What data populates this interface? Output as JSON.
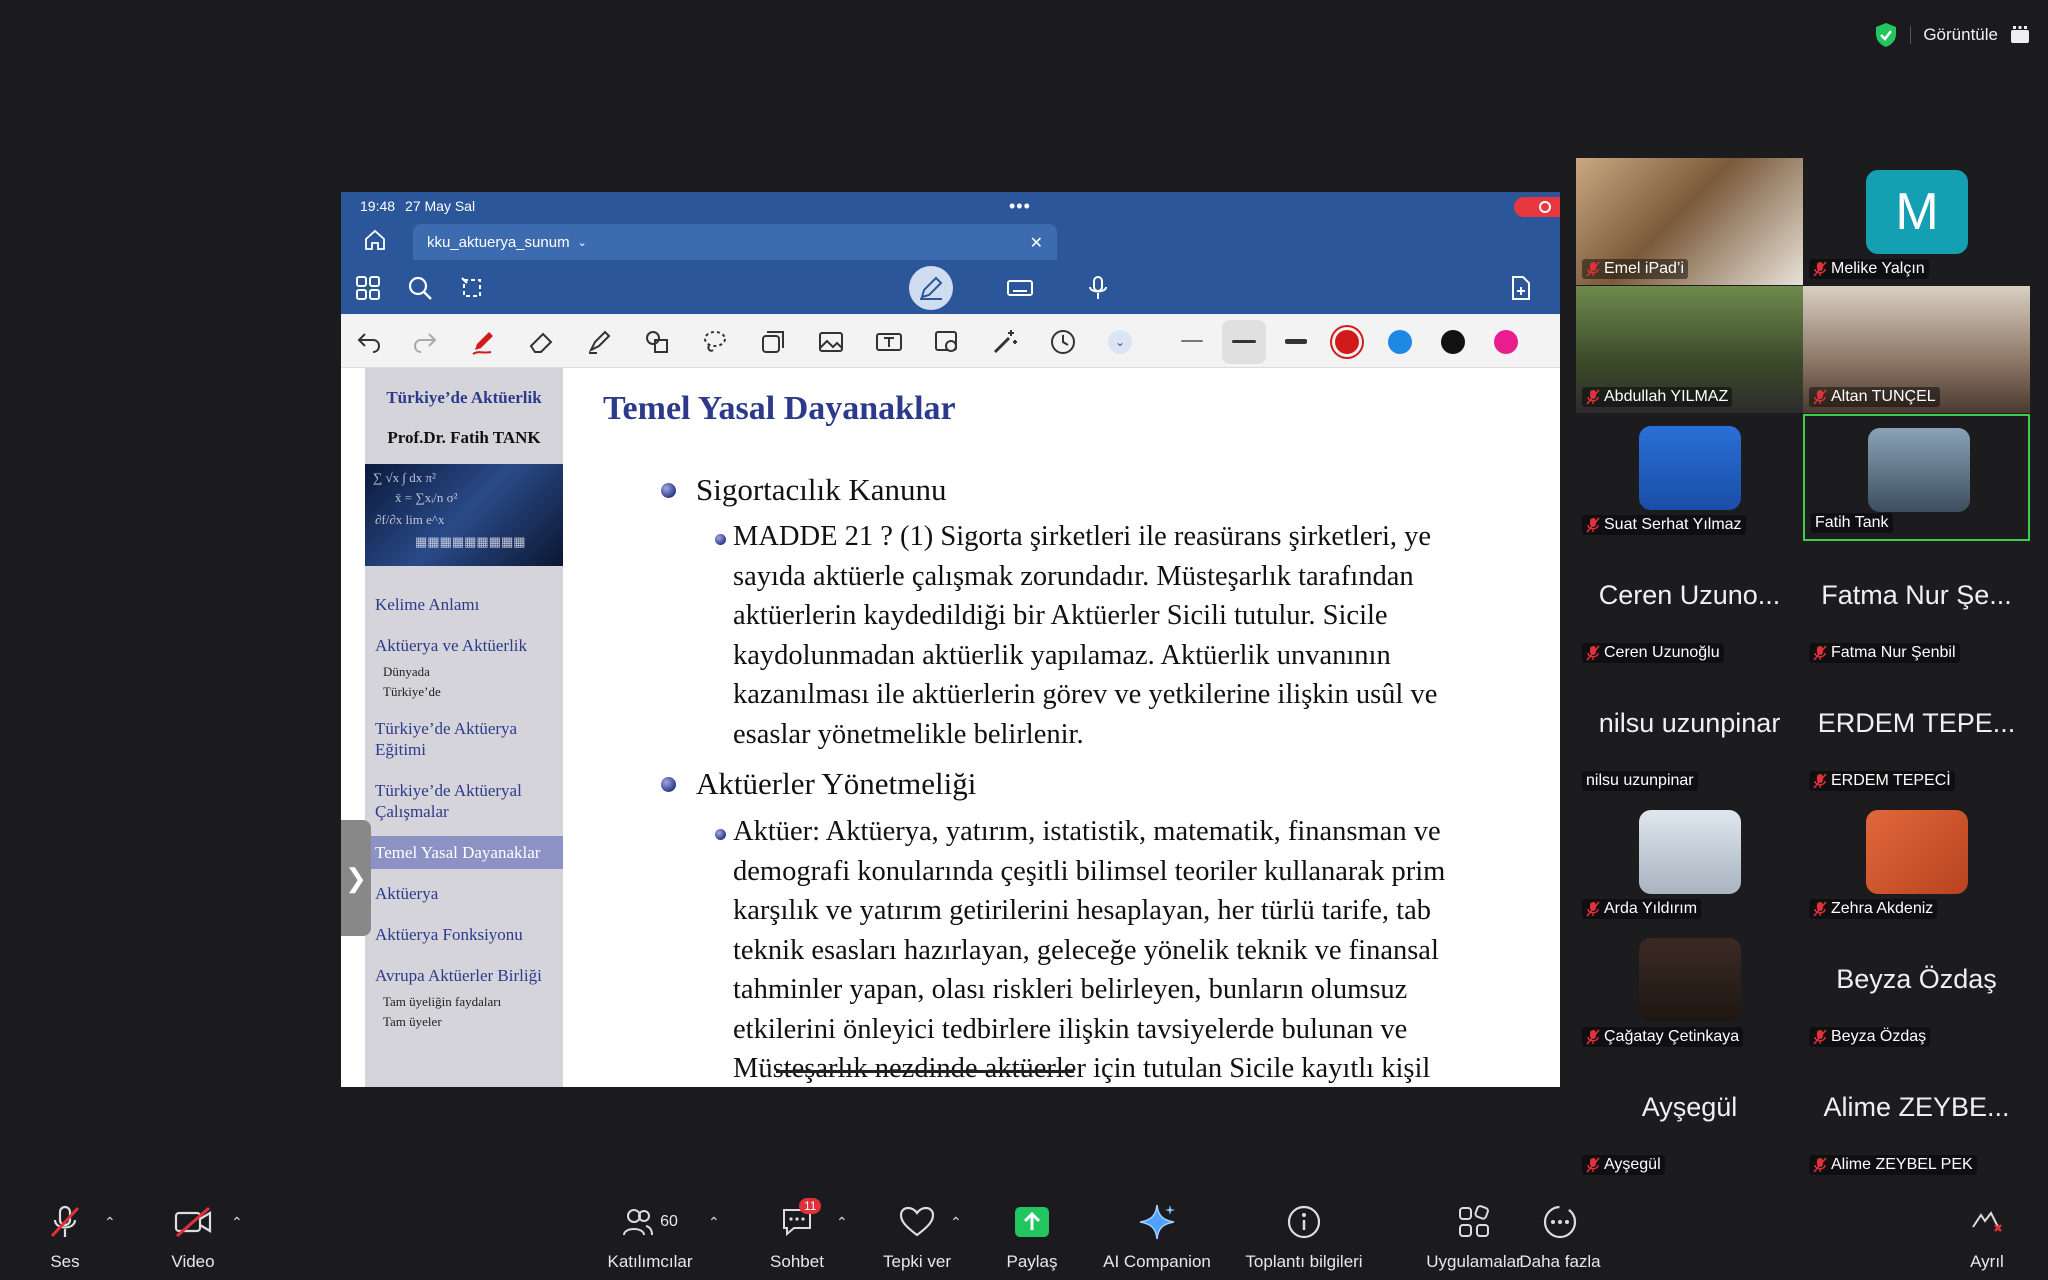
{
  "top": {
    "view_label": "Görüntüle"
  },
  "ipad": {
    "time": "19:48",
    "date": "27 May Sal",
    "doc_name": "kku_aktuerya_sunum"
  },
  "drawing": {
    "colors": [
      "#d11a1a",
      "#1e88e5",
      "#111111",
      "#e91e8c"
    ]
  },
  "slide": {
    "sidebar_title": "Türkiye’de Aktüerlik",
    "sidebar_author": "Prof.Dr. Fatih TANK",
    "nav": [
      {
        "label": "Kelime Anlamı",
        "type": "item"
      },
      {
        "label": "Aktüerya ve Aktüerlik",
        "type": "item"
      },
      {
        "label": "Dünyada",
        "type": "sub"
      },
      {
        "label": "Türkiye’de",
        "type": "sub"
      },
      {
        "label": "Türkiye’de Aktüerya Eğitimi",
        "type": "item"
      },
      {
        "label": "Türkiye’de Aktüeryal Çalışmalar",
        "type": "item"
      },
      {
        "label": "Temel Yasal Dayanaklar",
        "type": "active"
      },
      {
        "label": "Aktüerya",
        "type": "item"
      },
      {
        "label": "Aktüerya Fonksiyonu",
        "type": "item"
      },
      {
        "label": "Avrupa Aktüerler Birliği",
        "type": "item"
      },
      {
        "label": "Tam üyeliğin faydaları",
        "type": "sub"
      },
      {
        "label": "Tam üyeler",
        "type": "sub"
      }
    ],
    "title": "Temel Yasal Dayanaklar",
    "bullet1": "Sigortacılık Kanunu",
    "bullet1_text": "MADDE 21 ? (1) Sigorta şirketleri ile reasürans şirketleri, ye\nsayıda aktüerle çalışmak zorundadır. Müsteşarlık tarafından\naktüerlerin kaydedildiği bir Aktüerler Sicili tutulur. Sicile\nkaydolunmadan aktüerlik yapılamaz. Aktüerlik unvanının\nkazanılması ile aktüerlerin görev ve yetkilerine ilişkin usûl ve\nesaslar yönetmelikle belirlenir.",
    "bullet2": "Aktüerler Yönetmeliği",
    "bullet2_text": "Aktüer: Aktüerya, yatırım, istatistik, matematik, finansman ve\ndemografi konularında çeşitli bilimsel teoriler kullanarak prim\nkarşılık ve yatırım getirilerini hesaplayan, her türlü tarife, tab\nteknik esasları hazırlayan, geleceğe yönelik teknik ve finansal\ntahminler yapan, olası riskleri belirleyen, bunların olumsuz\netkilerini önleyici tedbirlere ilişkin tavsiyelerde bulunan ve\nMüsteşarlık nezdinde aktüerler için tutulan Sicile kayıtlı kişil"
  },
  "participants": [
    {
      "name": "Emel iPad’i",
      "kind": "video",
      "muted": true
    },
    {
      "name": "Melike Yalçın",
      "kind": "letter",
      "letter": "M",
      "muted": true
    },
    {
      "name": "Abdullah YILMAZ",
      "kind": "video",
      "muted": true
    },
    {
      "name": "Altan TUNÇEL",
      "kind": "video",
      "muted": true
    },
    {
      "name": "Suat Serhat Yılmaz",
      "kind": "avatar",
      "muted": true
    },
    {
      "name": "Fatih Tank",
      "kind": "avatar",
      "muted": false,
      "active": true
    },
    {
      "name": "Ceren Uzunoğlu",
      "kind": "text",
      "big": "Ceren Uzuno...",
      "muted": true
    },
    {
      "name": "Fatma Nur Şenbil",
      "kind": "text",
      "big": "Fatma Nur Şe...",
      "muted": true
    },
    {
      "name": "nilsu uzunpinar",
      "kind": "text",
      "big": "nilsu uzunpinar",
      "muted": false
    },
    {
      "name": "ERDEM TEPECİ",
      "kind": "text",
      "big": "ERDEM TEPE...",
      "muted": true
    },
    {
      "name": "Arda Yıldırım",
      "kind": "avatar",
      "muted": true
    },
    {
      "name": "Zehra Akdeniz",
      "kind": "avatar",
      "muted": true
    },
    {
      "name": "Çağatay Çetinkaya",
      "kind": "avatar",
      "muted": true
    },
    {
      "name": "Beyza Özdaş",
      "kind": "text",
      "big": "Beyza Özdaş",
      "muted": true
    },
    {
      "name": "Ayşegül",
      "kind": "text",
      "big": "Ayşegül",
      "muted": true
    },
    {
      "name": "Alime ZEYBEL PEK",
      "kind": "text",
      "big": "Alime ZEYBE...",
      "muted": true
    }
  ],
  "toolbar": {
    "audio": "Ses",
    "video": "Video",
    "participants": "Katılımcılar",
    "participants_count": "60",
    "chat": "Sohbet",
    "chat_badge": "11",
    "react": "Tepki ver",
    "share": "Paylaş",
    "ai": "AI Companion",
    "info": "Toplantı bilgileri",
    "apps": "Uygulamalar",
    "more": "Daha fazla",
    "leave": "Ayrıl"
  }
}
